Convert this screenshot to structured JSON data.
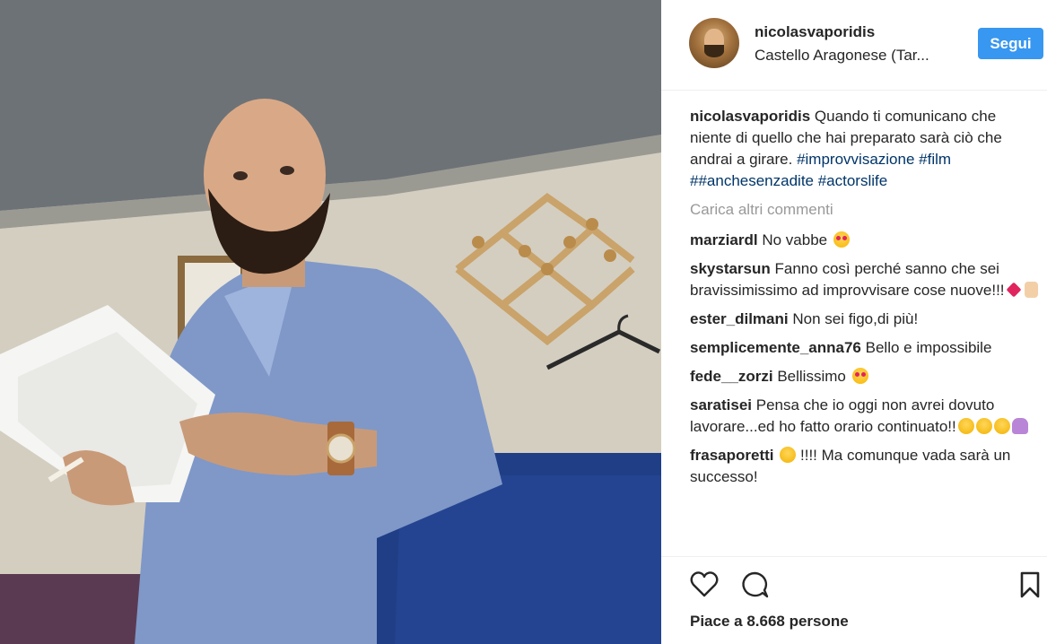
{
  "post": {
    "username": "nicolasvaporidis",
    "location": "Castello Aragonese (Tar...",
    "follow_label": "Segui"
  },
  "caption": {
    "user": "nicolasvaporidis",
    "text": "Quando ti comunicano che niente di quello che hai preparato sarà ciò che andrai a girare.",
    "tags": "#improvvisazione #film ##anchesenzadite #actorslife"
  },
  "load_more": "Carica altri commenti",
  "comments": [
    {
      "user": "marziardl",
      "text": "No vabbe"
    },
    {
      "user": "skystarsun",
      "text": "Fanno così perché sanno che sei bravissimissimo ad improvvisare cose nuove!!!"
    },
    {
      "user": "ester_dilmani",
      "text": "Non sei figo,di più!"
    },
    {
      "user": "semplicemente_anna76",
      "text": "Bello e impossibile"
    },
    {
      "user": "fede__zorzi",
      "text": "Bellissimo"
    },
    {
      "user": "saratisei",
      "text": "Pensa che io oggi non avrei dovuto lavorare...ed ho fatto orario continuato!!"
    },
    {
      "user": "frasaporetti",
      "text": "!!!! Ma comunque vada sarà un successo!"
    }
  ],
  "likes": "Piace a 8.668 persone",
  "icons": {
    "like": "heart-icon",
    "comment": "speech-bubble-icon",
    "save": "bookmark-icon"
  },
  "colors": {
    "follow_button": "#3897f0",
    "hashtag": "#003569",
    "muted": "#999999"
  }
}
